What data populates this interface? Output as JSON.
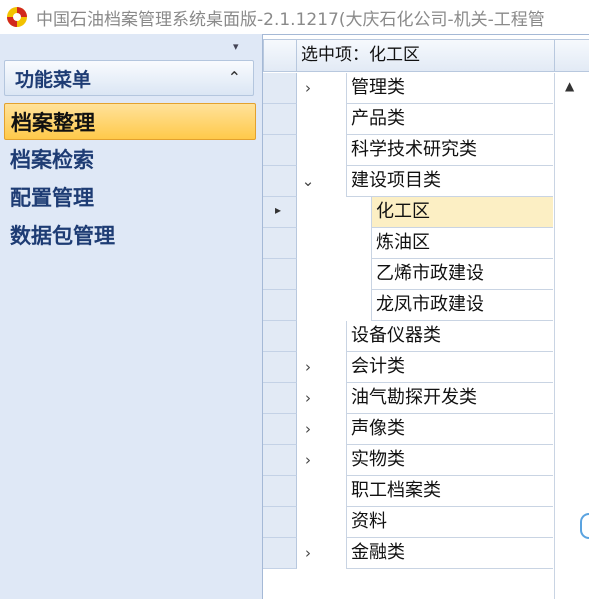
{
  "window": {
    "title": "中国石油档案管理系统桌面版-2.1.1217(大庆石化公司-机关-工程管"
  },
  "left_panel": {
    "header": "功能菜单",
    "items": [
      {
        "label": "档案整理",
        "active": true
      },
      {
        "label": "档案检索",
        "active": false
      },
      {
        "label": "配置管理",
        "active": false
      },
      {
        "label": "数据包管理",
        "active": false
      }
    ]
  },
  "tree": {
    "header": "选中项：化工区",
    "rows": [
      {
        "label": "管理类",
        "level": 0,
        "expander": "›",
        "selected": false
      },
      {
        "label": "产品类",
        "level": 0,
        "expander": "",
        "selected": false
      },
      {
        "label": "科学技术研究类",
        "level": 0,
        "expander": "",
        "selected": false
      },
      {
        "label": "建设项目类",
        "level": 0,
        "expander": "⌄",
        "selected": false
      },
      {
        "label": "化工区",
        "level": 1,
        "expander": "",
        "selected": true
      },
      {
        "label": "炼油区",
        "level": 1,
        "expander": "",
        "selected": false
      },
      {
        "label": "乙烯市政建设",
        "level": 1,
        "expander": "",
        "selected": false
      },
      {
        "label": "龙凤市政建设",
        "level": 1,
        "expander": "",
        "selected": false
      },
      {
        "label": "设备仪器类",
        "level": 0,
        "expander": "",
        "selected": false
      },
      {
        "label": "会计类",
        "level": 0,
        "expander": "›",
        "selected": false
      },
      {
        "label": "油气勘探开发类",
        "level": 0,
        "expander": "›",
        "selected": false
      },
      {
        "label": "声像类",
        "level": 0,
        "expander": "›",
        "selected": false
      },
      {
        "label": "实物类",
        "level": 0,
        "expander": "›",
        "selected": false
      },
      {
        "label": "职工档案类",
        "level": 0,
        "expander": "",
        "selected": false
      },
      {
        "label": "资料",
        "level": 0,
        "expander": "",
        "selected": false
      },
      {
        "label": "金融类",
        "level": 0,
        "expander": "›",
        "selected": false
      }
    ]
  },
  "icons": {
    "pin": "pin-icon",
    "collapse": "chevron-up-icon",
    "row_indicator": "row-indicator-arrow-icon",
    "scroll_up": "scroll-up-icon"
  },
  "colors": {
    "panel_bg": "#dfe8f6",
    "menu_text": "#1e3c74",
    "active_item": "#ffc94a",
    "selected_row": "#fcefc4"
  }
}
